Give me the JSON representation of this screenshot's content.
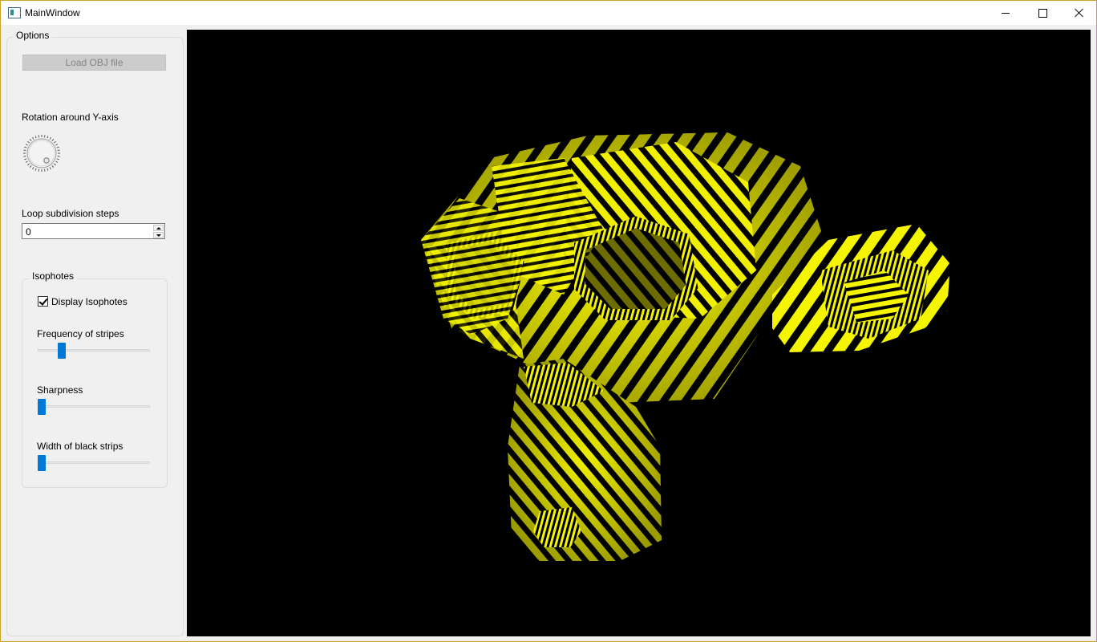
{
  "window": {
    "title": "MainWindow"
  },
  "options": {
    "group_title": "Options",
    "load_button": "Load OBJ file",
    "rotation_label": "Rotation around Y-axis",
    "rotation_value": 0,
    "subdivision_label": "Loop subdivision steps",
    "subdivision_value": "0"
  },
  "isophotes": {
    "group_title": "Isophotes",
    "display_label": "Display Isophotes",
    "display_checked": true,
    "frequency_label": "Frequency of stripes",
    "frequency_fraction": 0.19,
    "sharpness_label": "Sharpness",
    "sharpness_fraction": 0.0,
    "width_label": "Width of black strips",
    "width_fraction": 0.0
  },
  "viewport": {
    "background": "#000000",
    "stripe_color": "#f5f500"
  },
  "colors": {
    "accent": "#0078d7",
    "window_bg": "#f0f0f0",
    "border_accent": "#c9a227"
  }
}
